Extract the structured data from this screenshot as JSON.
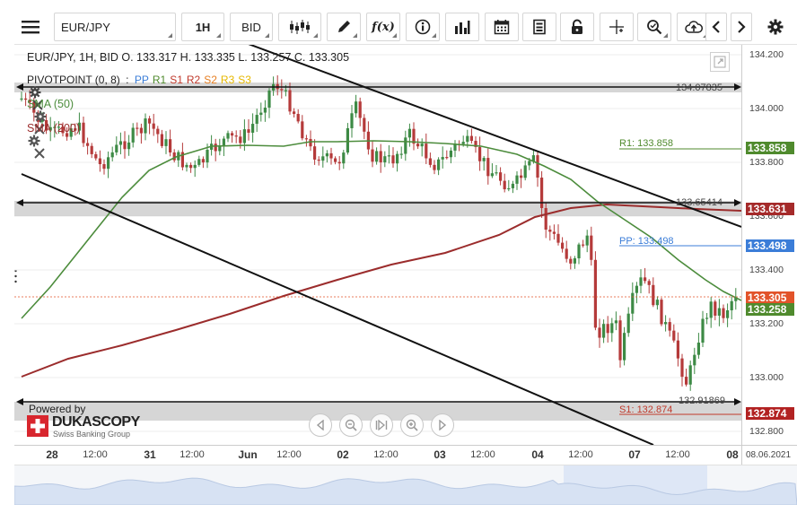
{
  "toolbar": {
    "instrument": "EUR/JPY",
    "timeframe": "1H",
    "price_side": "BID",
    "function_label": "f(x)"
  },
  "overlay": {
    "ohlc": "EUR/JPY, 1H, BID  O. 133.317 H. 133.335 L. 133.257 C. 133.305",
    "pivot_label": "PIVOTPOINT (0, 8)",
    "pivot_sep": ":",
    "pivot_items": [
      {
        "text": "PP",
        "color": "#3b7dd8"
      },
      {
        "text": "R1",
        "color": "#4f8a2d"
      },
      {
        "text": "S1",
        "color": "#c0392b"
      },
      {
        "text": "R2",
        "color": "#c0392b"
      },
      {
        "text": "S2",
        "color": "#e67e22"
      },
      {
        "text": "R3",
        "color": "#e6b800"
      },
      {
        "text": "S3",
        "color": "#e6b800"
      }
    ],
    "sma50": "SMA (50)",
    "sma200": "SMA (200)"
  },
  "levels": {
    "r1_label": "R1: 133.858",
    "pp_label": "PP: 133.498",
    "s1_label": "S1: 132.874",
    "hline_top": "134.07835",
    "hline_mid": "133.65414",
    "hline_bot": "132.91869"
  },
  "price_axis": {
    "ticks": [
      "134.200",
      "134.000",
      "133.800",
      "133.600",
      "133.400",
      "133.200",
      "133.000",
      "132.800"
    ],
    "labels": [
      {
        "text": "133.858",
        "color": "#4f8a2d"
      },
      {
        "text": "133.631",
        "color": "#a52a2a"
      },
      {
        "text": "133.498",
        "color": "#3b7dd8"
      },
      {
        "text": "133.305",
        "color": "#e2532a"
      },
      {
        "text": "133.258",
        "color": "#4f8a2d"
      },
      {
        "text": "132.874",
        "color": "#b22222"
      }
    ]
  },
  "time_axis": {
    "labels": [
      {
        "text": "28",
        "big": true
      },
      {
        "text": "12:00",
        "big": false
      },
      {
        "text": "31",
        "big": true
      },
      {
        "text": "12:00",
        "big": false
      },
      {
        "text": "Jun",
        "big": true
      },
      {
        "text": "12:00",
        "big": false
      },
      {
        "text": "02",
        "big": true
      },
      {
        "text": "12:00",
        "big": false
      },
      {
        "text": "03",
        "big": true
      },
      {
        "text": "12:00",
        "big": false
      },
      {
        "text": "04",
        "big": true
      },
      {
        "text": "12:00",
        "big": false
      },
      {
        "text": "07",
        "big": true
      },
      {
        "text": "12:00",
        "big": false
      },
      {
        "text": "08",
        "big": true
      }
    ],
    "date_label": "08.06.2021"
  },
  "branding": {
    "powered_by": "Powered by",
    "name": "DUKASCOPY",
    "tagline": "Swiss Banking Group"
  },
  "colors": {
    "sma50": "#4c8c3c",
    "sma200": "#9b2c2c",
    "up": "#3d8a45",
    "down": "#b53a3a"
  }
}
